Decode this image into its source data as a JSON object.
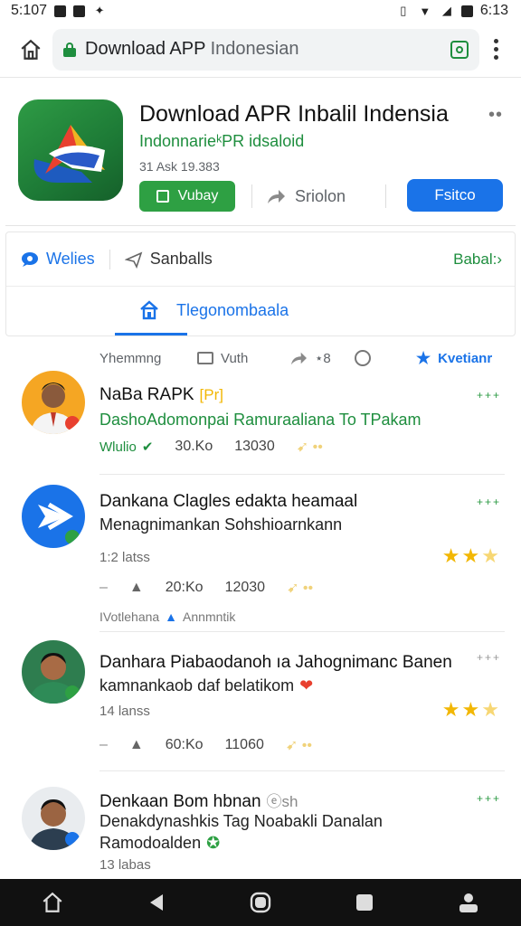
{
  "status_bar": {
    "time_left": "5:107",
    "time_right": "6:13"
  },
  "url_bar": {
    "title": "Download APP",
    "title_suffix": " Indonesian"
  },
  "app": {
    "title": "Download APR Inbalil Indensia",
    "subtitle": "IndonnarieᵏPR idsaloid",
    "meta": "31 Ask 19.383",
    "install_label": "Vubay",
    "share_label": "Sriolon",
    "open_label": "Fsitco"
  },
  "tabs": {
    "tab1": "Welies",
    "tab2": "Sanballs",
    "tab3": "Babal:›",
    "sub_tab": "Tlegonombaala"
  },
  "filters": {
    "f1": "Yhemmng",
    "f2": "Vuth",
    "f3": "⋆8",
    "f4": "Kvetianr"
  },
  "reviews": [
    {
      "name": "NaBa RAPK",
      "badge": "[Pr]",
      "text": "DashoAdomonpai Ramuraaliana To TPakam",
      "user_tag": "Wlulio",
      "stat1": "30.Ko",
      "stat2": "13030"
    },
    {
      "name": "Dankana Clagles edakta heamaal",
      "text": "Menagnimankan Sohshioarnkann",
      "time": "1:2 latss",
      "stat1": "20:Ko",
      "stat2": "12030",
      "hint": "IVotlehana",
      "hint2": "Annmntik"
    },
    {
      "name": "Danhara Piabaodanoh ıa Jahognimanc Banen",
      "text": "kamnankaob daf belatikom",
      "time": "14 lanss",
      "stat1": "60:Ko",
      "stat2": "11060"
    },
    {
      "name": "Denkaan Bom hbnan",
      "badge": "ⓔsh",
      "text": "Denakdynashkis Tag Noabakli Danalan",
      "text2": "Ramodoalden",
      "time": "13 labas"
    }
  ],
  "colors": {
    "green": "#1e8e3e",
    "blue": "#1a73e8",
    "star": "#f2b705"
  }
}
